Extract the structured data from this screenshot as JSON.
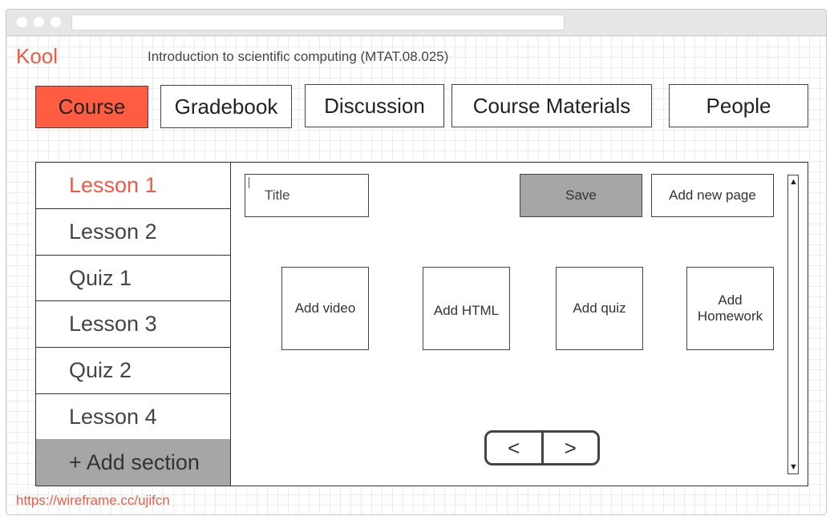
{
  "app": {
    "logo": "Kool",
    "course_title": "Introduction to scientific computing (MTAT.08.025)"
  },
  "tabs": [
    {
      "label": "Course",
      "active": true
    },
    {
      "label": "Gradebook"
    },
    {
      "label": "Discussion"
    },
    {
      "label": "Course Materials"
    },
    {
      "label": "People"
    }
  ],
  "sidebar": {
    "items": [
      {
        "label": "Lesson 1",
        "active": true
      },
      {
        "label": "Lesson 2"
      },
      {
        "label": "Quiz 1"
      },
      {
        "label": "Lesson 3"
      },
      {
        "label": "Quiz 2"
      },
      {
        "label": "Lesson 4"
      }
    ],
    "add_section": "+ Add section"
  },
  "editor": {
    "title_placeholder": "Title",
    "save_label": "Save",
    "add_page_label": "Add new page",
    "add_video": "Add video",
    "add_html": "Add HTML",
    "add_quiz": "Add quiz",
    "add_homework": "Add Homework"
  },
  "pager": {
    "prev": "<",
    "next": ">"
  },
  "scroll": {
    "up": "▲",
    "down": "▼"
  },
  "footer": {
    "link": "https://wireframe.cc/ujifcn"
  },
  "colors": {
    "accent": "#ff5c42",
    "brand_text": "#f05a44",
    "button_grey": "#a6a6a6"
  }
}
